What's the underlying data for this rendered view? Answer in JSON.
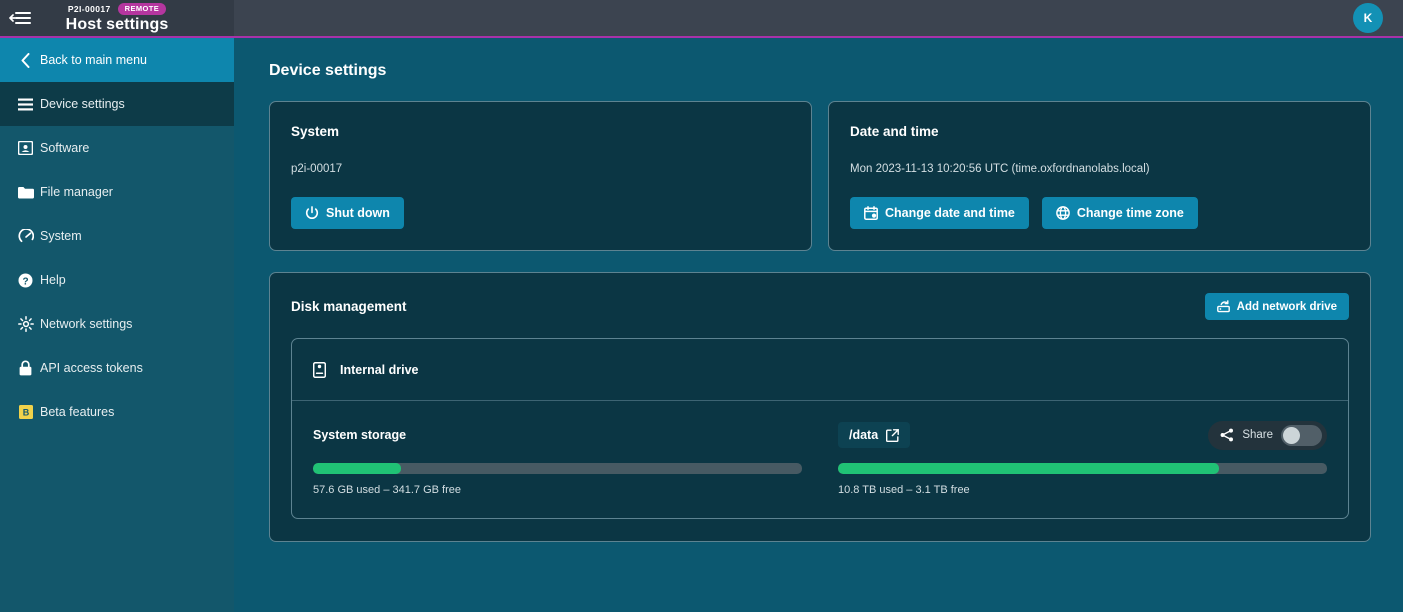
{
  "topbar": {
    "menu_icon": "collapse-sidebar-icon",
    "host_id": "P2I-00017",
    "badge": "REMOTE",
    "title": "Host settings",
    "avatar_initial": "K"
  },
  "sidebar": {
    "back_label": "Back to main menu",
    "back_icon": "chevron-left-icon",
    "items": [
      {
        "label": "Device settings",
        "icon": "list-icon",
        "active": true
      },
      {
        "label": "Software",
        "icon": "software-icon",
        "active": false
      },
      {
        "label": "File manager",
        "icon": "folder-icon",
        "active": false
      },
      {
        "label": "System",
        "icon": "gauge-icon",
        "active": false
      },
      {
        "label": "Help",
        "icon": "help-icon",
        "active": false
      },
      {
        "label": "Network settings",
        "icon": "network-icon",
        "active": false
      },
      {
        "label": "API access tokens",
        "icon": "lock-icon",
        "active": false
      },
      {
        "label": "Beta features",
        "icon": "beta-icon",
        "active": false
      }
    ]
  },
  "main": {
    "page_title": "Device settings",
    "system_card": {
      "title": "System",
      "device_name": "p2i-00017",
      "shutdown_label": "Shut down",
      "shutdown_icon": "power-icon"
    },
    "datetime_card": {
      "title": "Date and time",
      "current": "Mon 2023-11-13 10:20:56 UTC (time.oxfordnanolabs.local)",
      "change_datetime_label": "Change date and time",
      "change_datetime_icon": "calendar-icon",
      "change_timezone_label": "Change time zone",
      "change_timezone_icon": "globe-icon"
    },
    "disk_card": {
      "title": "Disk management",
      "add_drive_label": "Add network drive",
      "add_drive_icon": "network-drive-icon",
      "drive": {
        "name": "Internal drive",
        "icon": "hard-drive-icon",
        "volumes": [
          {
            "name": "System storage",
            "kind": "label",
            "percent": 18,
            "meta": "57.6 GB used – 341.7 GB free"
          },
          {
            "name": "/data",
            "kind": "path",
            "path_icon": "external-link-icon",
            "share_label": "Share",
            "share_icon": "share-icon",
            "share_on": false,
            "percent": 78,
            "meta": "10.8 TB used – 3.1 TB free"
          }
        ]
      }
    }
  },
  "colors": {
    "page_bg": "#0c5870",
    "card_bg": "#0b3644",
    "accent_blue": "#0e86ad",
    "accent_magenta": "#b5369f",
    "progress_green": "#20c275"
  }
}
